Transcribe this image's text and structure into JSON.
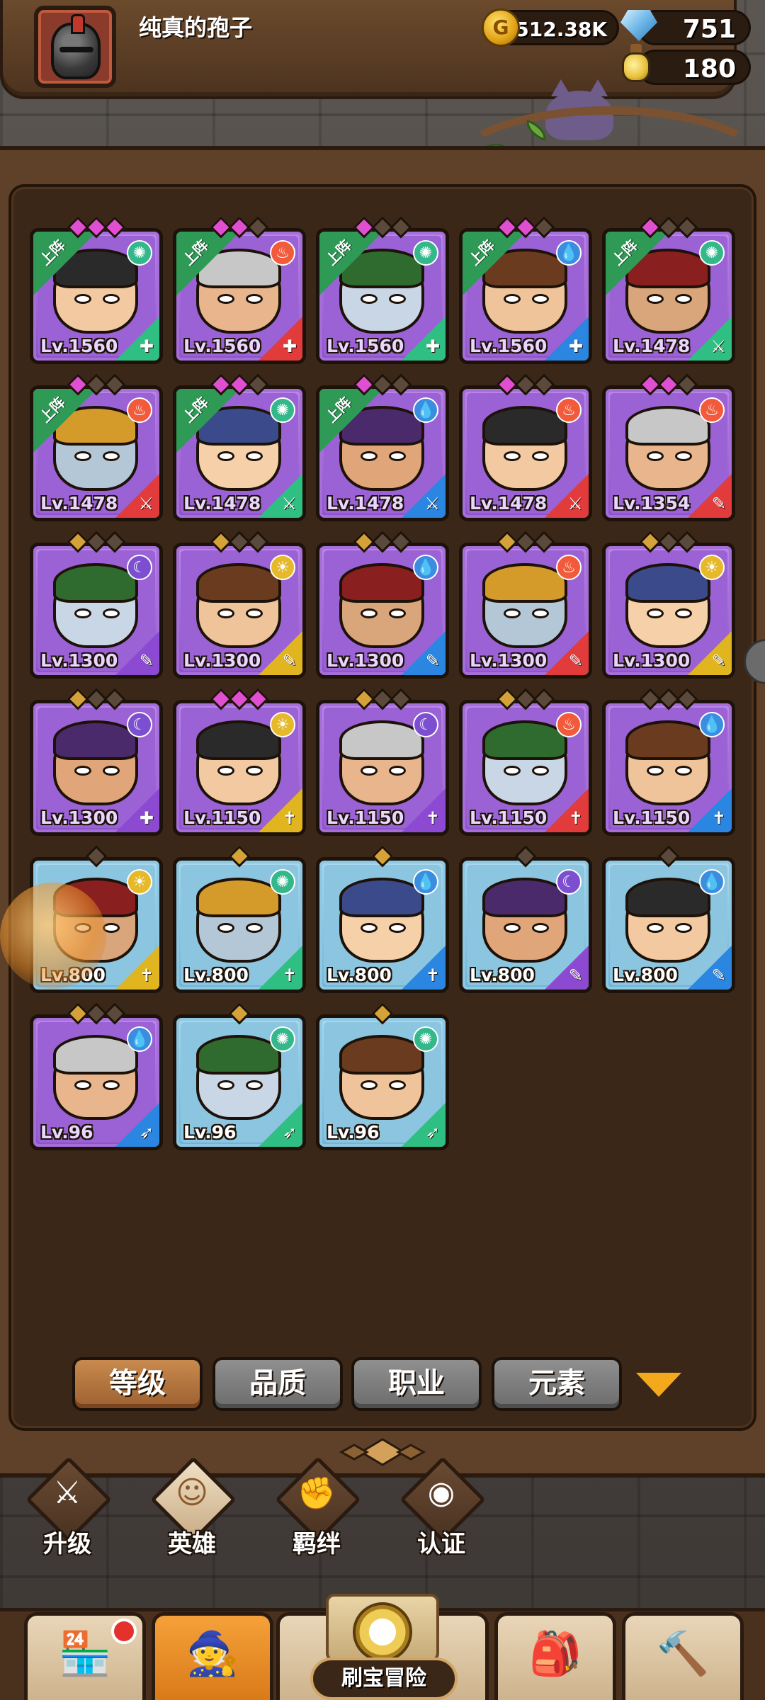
{
  "player": {
    "name": "纯真的孢子",
    "coins": "512.38K",
    "gems": "751",
    "potions": "180"
  },
  "colors": {
    "purple_card": "#9a62d4",
    "blue_card": "#8cc5df",
    "active_tab": "#c98a4e",
    "inactive_tab": "#7c7c7c"
  },
  "heroes": [
    {
      "level": "Lv.1560",
      "deploy": "上阵",
      "element": "wind",
      "role": "shield",
      "rarity": "purple",
      "stars": [
        "pink",
        "pink",
        "pink"
      ]
    },
    {
      "level": "Lv.1560",
      "deploy": "上阵",
      "element": "fire",
      "role": "shield",
      "rarity": "purple",
      "stars": [
        "pink",
        "pink",
        "dark"
      ]
    },
    {
      "level": "Lv.1560",
      "deploy": "上阵",
      "element": "wind",
      "role": "shield",
      "rarity": "purple",
      "stars": [
        "pink",
        "dark",
        "dark"
      ]
    },
    {
      "level": "Lv.1560",
      "deploy": "上阵",
      "element": "water",
      "role": "shield",
      "rarity": "purple",
      "stars": [
        "pink",
        "pink",
        "dark"
      ]
    },
    {
      "level": "Lv.1478",
      "deploy": "上阵",
      "element": "wind",
      "role": "sword",
      "rarity": "purple",
      "stars": [
        "pink",
        "dark",
        "dark"
      ]
    },
    {
      "level": "Lv.1478",
      "deploy": "上阵",
      "element": "fire",
      "role": "sword",
      "rarity": "purple",
      "stars": [
        "pink",
        "dark",
        "dark"
      ]
    },
    {
      "level": "Lv.1478",
      "deploy": "上阵",
      "element": "wind",
      "role": "sword",
      "rarity": "purple",
      "stars": [
        "pink",
        "pink",
        "dark"
      ]
    },
    {
      "level": "Lv.1478",
      "deploy": "上阵",
      "element": "water",
      "role": "sword",
      "rarity": "purple",
      "stars": [
        "pink",
        "dark",
        "dark"
      ]
    },
    {
      "level": "Lv.1478",
      "deploy": "",
      "element": "fire",
      "role": "sword",
      "rarity": "purple",
      "stars": [
        "pink",
        "dark",
        "dark"
      ]
    },
    {
      "level": "Lv.1354",
      "deploy": "",
      "element": "fire",
      "role": "mic",
      "rarity": "purple",
      "stars": [
        "pink",
        "pink",
        "dark"
      ]
    },
    {
      "level": "Lv.1300",
      "deploy": "",
      "element": "dark",
      "role": "mic",
      "rarity": "purple",
      "stars": [
        "gold",
        "dark",
        "dark"
      ]
    },
    {
      "level": "Lv.1300",
      "deploy": "",
      "element": "light",
      "role": "mic",
      "rarity": "purple",
      "stars": [
        "gold",
        "dark",
        "dark"
      ]
    },
    {
      "level": "Lv.1300",
      "deploy": "",
      "element": "water",
      "role": "mic",
      "rarity": "purple",
      "stars": [
        "gold",
        "dark",
        "dark"
      ]
    },
    {
      "level": "Lv.1300",
      "deploy": "",
      "element": "fire",
      "role": "mic",
      "rarity": "purple",
      "stars": [
        "gold",
        "dark",
        "dark"
      ]
    },
    {
      "level": "Lv.1300",
      "deploy": "",
      "element": "light",
      "role": "mic",
      "rarity": "purple",
      "stars": [
        "gold",
        "dark",
        "dark"
      ]
    },
    {
      "level": "Lv.1300",
      "deploy": "",
      "element": "dark",
      "role": "shield",
      "rarity": "purple",
      "stars": [
        "gold",
        "dark",
        "dark"
      ]
    },
    {
      "level": "Lv.1150",
      "deploy": "",
      "element": "light",
      "role": "cross",
      "rarity": "purple",
      "stars": [
        "pink",
        "pink",
        "pink"
      ]
    },
    {
      "level": "Lv.1150",
      "deploy": "",
      "element": "dark",
      "role": "cross",
      "rarity": "purple",
      "stars": [
        "gold",
        "dark",
        "dark"
      ]
    },
    {
      "level": "Lv.1150",
      "deploy": "",
      "element": "fire",
      "role": "cross",
      "rarity": "purple",
      "stars": [
        "gold",
        "dark",
        "dark"
      ]
    },
    {
      "level": "Lv.1150",
      "deploy": "",
      "element": "water",
      "role": "cross",
      "rarity": "purple",
      "stars": [
        "dark",
        "dark",
        "dark"
      ]
    },
    {
      "level": "Lv.800",
      "deploy": "",
      "element": "light",
      "role": "cross",
      "rarity": "blue",
      "stars": [
        "dark"
      ]
    },
    {
      "level": "Lv.800",
      "deploy": "",
      "element": "wind",
      "role": "cross",
      "rarity": "blue",
      "stars": [
        "gold"
      ]
    },
    {
      "level": "Lv.800",
      "deploy": "",
      "element": "water",
      "role": "cross",
      "rarity": "blue",
      "stars": [
        "gold"
      ]
    },
    {
      "level": "Lv.800",
      "deploy": "",
      "element": "dark",
      "role": "mic",
      "rarity": "blue",
      "stars": [
        "dark"
      ]
    },
    {
      "level": "Lv.800",
      "deploy": "",
      "element": "water",
      "role": "mic",
      "rarity": "blue",
      "stars": [
        "dark"
      ]
    },
    {
      "level": "Lv.96",
      "deploy": "",
      "element": "water",
      "role": "bow",
      "rarity": "purple",
      "stars": [
        "gold",
        "dark",
        "dark"
      ]
    },
    {
      "level": "Lv.96",
      "deploy": "",
      "element": "wind",
      "role": "bow",
      "rarity": "blue",
      "stars": [
        "gold"
      ]
    },
    {
      "level": "Lv.96",
      "deploy": "",
      "element": "wind",
      "role": "bow",
      "rarity": "blue",
      "stars": [
        "gold"
      ]
    }
  ],
  "sort_tabs": [
    {
      "label": "等级",
      "active": true
    },
    {
      "label": "品质",
      "active": false
    },
    {
      "label": "职业",
      "active": false
    },
    {
      "label": "元素",
      "active": false
    }
  ],
  "sub_nav": [
    {
      "label": "升级",
      "icon": "sword-icon",
      "active": false
    },
    {
      "label": "英雄",
      "icon": "hero-icon",
      "active": true
    },
    {
      "label": "羁绊",
      "icon": "fist-icon",
      "active": false
    },
    {
      "label": "认证",
      "icon": "eye-icon",
      "active": false
    }
  ],
  "bottom_nav": {
    "shop": "shop-icon",
    "heroes": "hero-portrait-icon",
    "adventure_label": "刷宝冒险",
    "bag": "backpack-icon",
    "forge": "hammer-icon"
  }
}
